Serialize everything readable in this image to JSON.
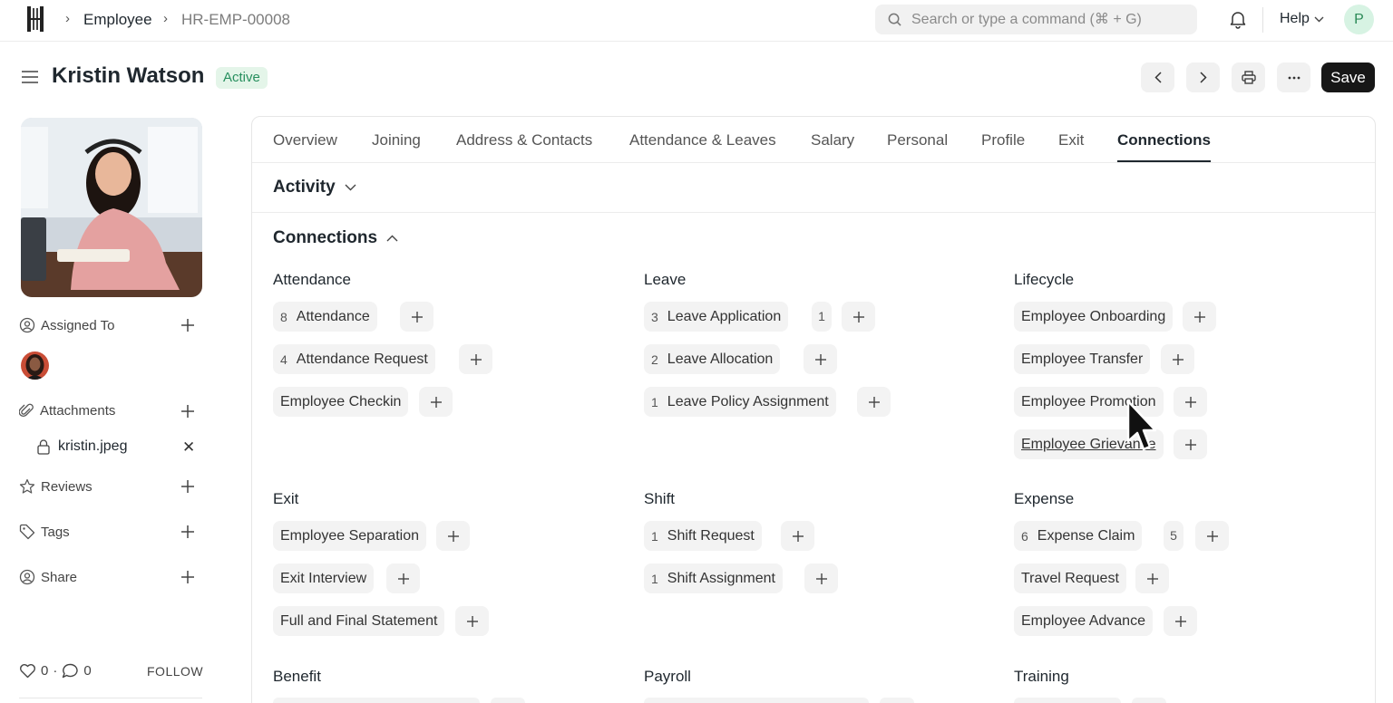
{
  "navbar": {
    "breadcrumb": [
      "Employee",
      "HR-EMP-00008"
    ],
    "search_placeholder": "Search or type a command (⌘ + G)",
    "help_label": "Help",
    "user_initial": "P"
  },
  "header": {
    "title": "Kristin Watson",
    "status": "Active",
    "save_label": "Save"
  },
  "sidebar": {
    "assigned_to": "Assigned To",
    "attachments": "Attachments",
    "attachment_file": "kristin.jpeg",
    "reviews": "Reviews",
    "tags": "Tags",
    "share": "Share",
    "likes": "0",
    "comments": "0",
    "follow": "FOLLOW"
  },
  "tabs": [
    "Overview",
    "Joining",
    "Address & Contacts",
    "Attendance & Leaves",
    "Salary",
    "Personal",
    "Profile",
    "Exit",
    "Connections"
  ],
  "active_tab": "Connections",
  "sections": {
    "activity": "Activity",
    "connections": "Connections"
  },
  "groups": {
    "attendance": {
      "title": "Attendance",
      "items": [
        {
          "count": "8",
          "label": "Attendance"
        },
        {
          "count": "4",
          "label": "Attendance Request"
        },
        {
          "count": "",
          "label": "Employee Checkin"
        }
      ]
    },
    "leave": {
      "title": "Leave",
      "items": [
        {
          "count": "3",
          "label": "Leave Application",
          "badge": "1"
        },
        {
          "count": "2",
          "label": "Leave Allocation"
        },
        {
          "count": "1",
          "label": "Leave Policy Assignment"
        }
      ]
    },
    "lifecycle": {
      "title": "Lifecycle",
      "items": [
        {
          "label": "Employee Onboarding"
        },
        {
          "label": "Employee Transfer"
        },
        {
          "label": "Employee Promotion"
        },
        {
          "label": "Employee Grievance"
        }
      ]
    },
    "exit": {
      "title": "Exit",
      "items": [
        {
          "label": "Employee Separation"
        },
        {
          "label": "Exit Interview"
        },
        {
          "label": "Full and Final Statement"
        }
      ]
    },
    "shift": {
      "title": "Shift",
      "items": [
        {
          "count": "1",
          "label": "Shift Request"
        },
        {
          "count": "1",
          "label": "Shift Assignment"
        }
      ]
    },
    "expense": {
      "title": "Expense",
      "items": [
        {
          "count": "6",
          "label": "Expense Claim",
          "badge": "5"
        },
        {
          "label": "Travel Request"
        },
        {
          "label": "Employee Advance"
        }
      ]
    },
    "benefit": {
      "title": "Benefit"
    },
    "payroll": {
      "title": "Payroll"
    },
    "training": {
      "title": "Training"
    }
  },
  "colors": {
    "accent_dark": "#171717",
    "status_green": "#278f5e",
    "status_bg": "#e4f5e9"
  },
  "icons": [
    "logo",
    "chevron-right-icon",
    "search-icon",
    "bell-icon",
    "chevron-down-icon",
    "hamburger-icon",
    "chevron-left-icon",
    "printer-icon",
    "more-icon",
    "plus-icon",
    "user-assign-icon",
    "paperclip-icon",
    "lock-icon",
    "close-icon",
    "star-icon",
    "tag-icon",
    "heart-icon",
    "comment-icon",
    "chevron-up-icon",
    "cursor"
  ]
}
